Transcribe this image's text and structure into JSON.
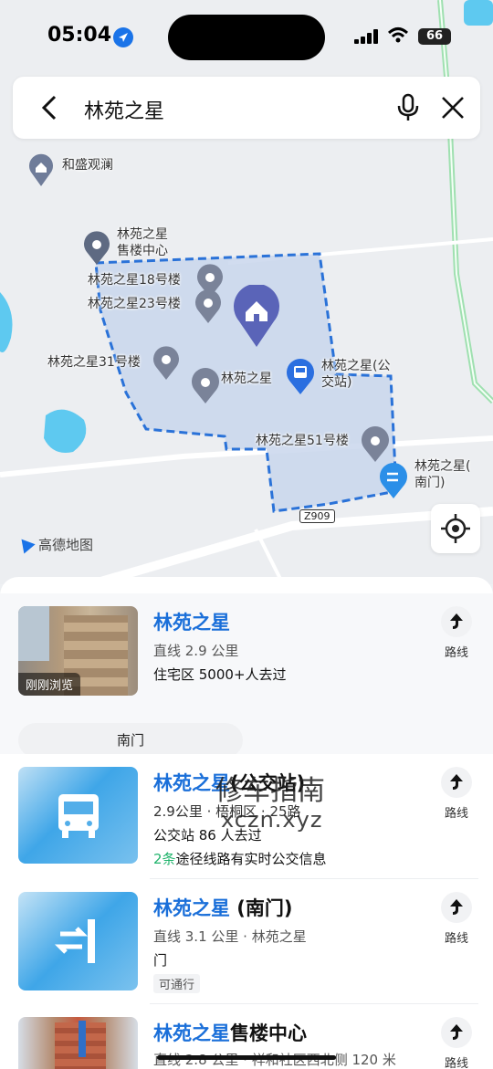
{
  "status_bar": {
    "time": "05:04",
    "battery": "66"
  },
  "search": {
    "query": "林苑之星"
  },
  "map": {
    "pois": [
      {
        "label": "和盛观澜"
      },
      {
        "label": "林苑之星\n售楼中心"
      },
      {
        "label": "林苑之星18号楼"
      },
      {
        "label": "林苑之星23号楼"
      },
      {
        "label": "林苑之星31号楼"
      },
      {
        "label": "林苑之星"
      },
      {
        "label": "林苑之星(公\n交站)"
      },
      {
        "label": "林苑之星51号楼"
      },
      {
        "label": "林苑之星(\n南门)"
      }
    ],
    "logo": "高德地图",
    "road": "Z909",
    "road_text": "Z909"
  },
  "results": [
    {
      "title_blue": "林苑之星",
      "title_rest": "",
      "meta": "直线 2.9 公里",
      "info": "住宅区  5000+人去过",
      "thumb_caption": "刚刚浏览",
      "chip": "南门",
      "route_label": "路线"
    },
    {
      "title_blue": "林苑之星",
      "title_rest": "(公交站)",
      "meta": "2.9公里 · 梧桐区  · 25路",
      "info": "公交站  86 人去过",
      "extra_green": "2条",
      "extra": "途径线路有实时公交信息",
      "route_label": "路线"
    },
    {
      "title_blue": "林苑之星",
      "title_rest": " (南门)",
      "meta": "直线 3.1 公里 · 林苑之星",
      "info": "门",
      "tag": "可通行",
      "route_label": "路线"
    },
    {
      "title_blue": "林苑之星",
      "title_rest": "售楼中心",
      "meta": "直线 2.8 公里 · 祥和社区西北侧 120 米",
      "route_label": "路线"
    }
  ],
  "watermark": {
    "line1": "修车指南",
    "line2": "xczn.xyz"
  },
  "colors": {
    "accent": "#1a6fd9",
    "map_area": "#c9d6ec",
    "boundary": "#2a72d8",
    "green": "#1fb36b"
  }
}
